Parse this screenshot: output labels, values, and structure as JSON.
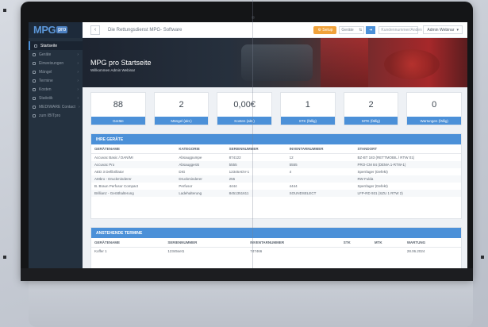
{
  "topbar": {
    "logo_mpg": "MPG",
    "logo_pro": "pro",
    "menu_toggle": "‹",
    "app_title": "Die Rettungsdienst MPG- Software",
    "setup_button": "⚙ Setup",
    "field1_value": "Geräte",
    "field1_suffix": "⇅",
    "go_button": "➜",
    "search_placeholder": "Kundennummer/Anden",
    "user_menu": "Admin Webinar",
    "user_chevron": "▾"
  },
  "sidebar": {
    "items": [
      {
        "label": "Startseite",
        "active": true
      },
      {
        "label": "Geräte",
        "chev": "›"
      },
      {
        "label": "Einweisungen",
        "chev": "›"
      },
      {
        "label": "Mängel",
        "chev": "›"
      },
      {
        "label": "Termine",
        "chev": "›"
      },
      {
        "label": "Kosten",
        "chev": "›"
      },
      {
        "label": "Statistik",
        "chev": "›"
      },
      {
        "label": "MEDIWARE Contact",
        "chev": "›"
      },
      {
        "label": "zum IBITpro",
        "chev": ""
      }
    ]
  },
  "hero": {
    "title": "MPG pro Startseite",
    "subtitle": "Willkommen Admin Webinar"
  },
  "stats": [
    {
      "value": "88",
      "label": "Geräte"
    },
    {
      "value": "2",
      "label": "Mängel (akt.)"
    },
    {
      "value": "0,00€",
      "label": "Kosten (akt.)"
    },
    {
      "value": "1",
      "label": "STK (fällig)"
    },
    {
      "value": "2",
      "label": "MTK (fällig)"
    },
    {
      "value": "0",
      "label": "Wartungen (fällig)"
    }
  ],
  "devices": {
    "title": "IHRE GERÄTE",
    "columns": [
      "GERÄTENAME",
      "KATEGORIE",
      "SERIENNUMMER",
      "INVENTARNUMMER",
      "STANDORT"
    ],
    "rows": [
      [
        "Accuvac Basic / DAN/MI",
        "Absaugpumpe",
        "874122",
        "12",
        "BZ-BT 183 (RETTMOBIL / RTW 01)"
      ],
      [
        "Accuvac Pro",
        "Absauggerät",
        "5555",
        "5555",
        "PRO-CM 84 (DEMA 1-RTW-1)"
      ],
      [
        "AED 3 Defibrillator",
        "DIG",
        "12345ADV-1",
        "4",
        "Sperrlager (Defekt)"
      ],
      [
        "AMbro - Druckminderer",
        "Druckminderer",
        "255",
        "",
        "RW Fulda"
      ],
      [
        "B. Braun Perfusor Compact",
        "Perfusor",
        "4444",
        "4444",
        "Sperrlager (Defekt)"
      ],
      [
        "Brillianz - Geräthalterung",
        "Ladehalterung",
        "8451351611",
        "SOUNDSELECT",
        "LFP-RD 931 (SZU 1 RTW 2)"
      ]
    ]
  },
  "appointments": {
    "title": "ANSTEHENDE TERMINE",
    "columns": [
      "GERÄTENAME",
      "SERIENNUMMER",
      "INVENTARNUMMER",
      "STK",
      "MTK",
      "WARTUNG"
    ],
    "rows": [
      [
        "Koffer 1",
        "12345set1",
        "747466",
        "",
        "",
        "28.06.2024"
      ]
    ]
  }
}
